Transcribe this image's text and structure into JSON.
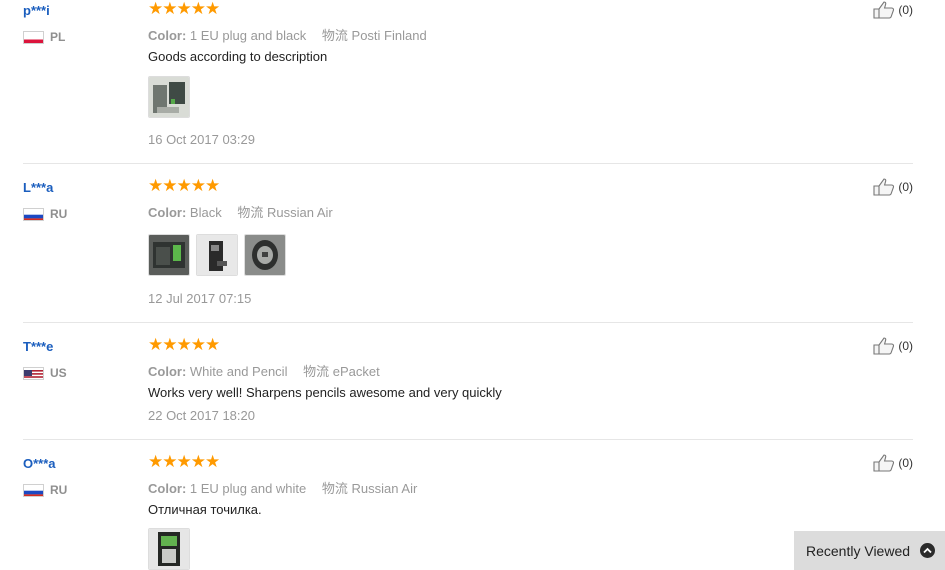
{
  "reviews": [
    {
      "user": "p***i",
      "country": "PL",
      "rating": 5,
      "color_label": "Color:",
      "color_value": "1 EU plug and black",
      "logistics_label": "物流",
      "logistics_value": "Posti Finland",
      "text": "Goods according to description",
      "photos": 1,
      "date": "16 Oct 2017 03:29",
      "helpful": "(0)"
    },
    {
      "user": "L***a",
      "country": "RU",
      "rating": 5,
      "color_label": "Color:",
      "color_value": "Black",
      "logistics_label": "物流",
      "logistics_value": "Russian Air",
      "text": "",
      "photos": 3,
      "date": "12 Jul 2017 07:15",
      "helpful": "(0)"
    },
    {
      "user": "T***e",
      "country": "US",
      "rating": 5,
      "color_label": "Color:",
      "color_value": "White and Pencil",
      "logistics_label": "物流",
      "logistics_value": "ePacket",
      "text": "Works very well! Sharpens pencils awesome and very quickly",
      "photos": 0,
      "date": "22 Oct 2017 18:20",
      "helpful": "(0)"
    },
    {
      "user": "O***a",
      "country": "RU",
      "rating": 5,
      "color_label": "Color:",
      "color_value": "1 EU plug and white",
      "logistics_label": "物流",
      "logistics_value": "Russian Air",
      "text": "Отличная точилка.",
      "photos": 1,
      "date": "",
      "helpful": "(0)"
    }
  ],
  "recently_viewed": {
    "label": "Recently Viewed",
    "icon": "chevron-up-circle-icon"
  },
  "colors": {
    "username": "#1b5ebe",
    "star": "#ff9a00",
    "muted": "#999999",
    "divider": "#e6e6e6",
    "recent_bg": "#dcdcdc"
  }
}
